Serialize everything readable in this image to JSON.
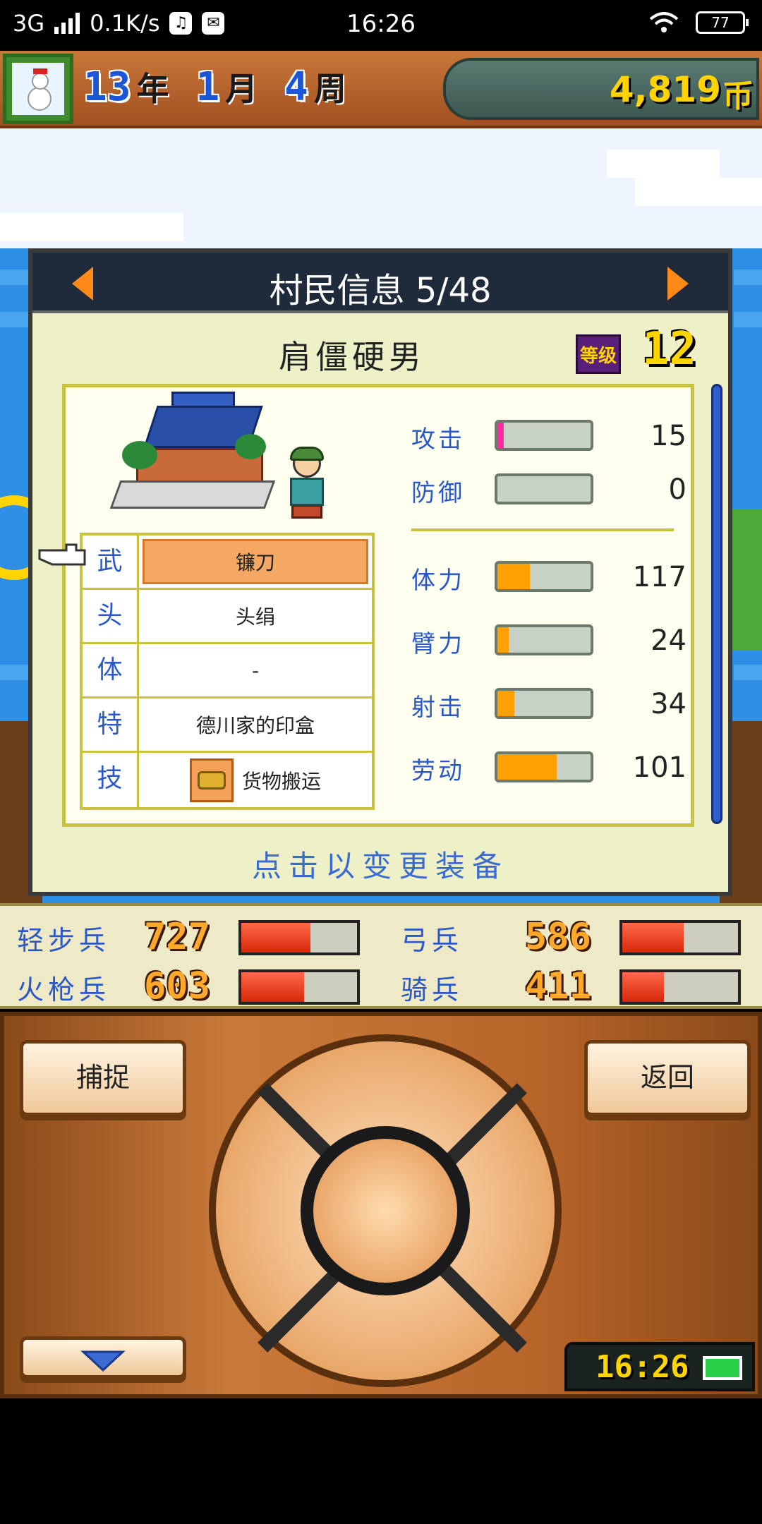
{
  "status_bar": {
    "network": "3G",
    "speed": "0.1K/s",
    "time": "16:26",
    "battery": "77"
  },
  "top_bar": {
    "year": "13",
    "year_unit": "年",
    "month": "1",
    "month_unit": "月",
    "week": "4",
    "week_unit": "周",
    "money": "4,819",
    "money_unit": "币"
  },
  "panel": {
    "title": "村民信息 5/48",
    "name": "肩僵硬男",
    "level_label": "等级",
    "level": "12",
    "hint": "点击以变更装备"
  },
  "equipment": [
    {
      "key": "武",
      "value": "镰刀"
    },
    {
      "key": "头",
      "value": "头绢"
    },
    {
      "key": "体",
      "value": "-"
    },
    {
      "key": "特",
      "value": "德川家的印盒"
    },
    {
      "key": "技",
      "value": "货物搬运"
    }
  ],
  "stats": [
    {
      "label": "攻击",
      "value": "15",
      "fraction": 0.07,
      "color": "#ff2aa0"
    },
    {
      "label": "防御",
      "value": "0",
      "fraction": 0.0,
      "color": "#ff2aa0"
    },
    {
      "label": "体力",
      "value": "117",
      "fraction": 0.35,
      "color": "#ffa000"
    },
    {
      "label": "臂力",
      "value": "24",
      "fraction": 0.12,
      "color": "#ffa000"
    },
    {
      "label": "射击",
      "value": "34",
      "fraction": 0.18,
      "color": "#ffa000"
    },
    {
      "label": "劳动",
      "value": "101",
      "fraction": 0.64,
      "color": "#ffa000"
    }
  ],
  "troops": [
    {
      "label": "轻步兵",
      "value": "727",
      "fraction": 0.6
    },
    {
      "label": "弓兵",
      "value": "586",
      "fraction": 0.53
    },
    {
      "label": "火枪兵",
      "value": "603",
      "fraction": 0.54
    },
    {
      "label": "骑兵",
      "value": "411",
      "fraction": 0.36
    }
  ],
  "controls": {
    "left_button": "捕捉",
    "right_button": "返回",
    "clock": "16:26"
  }
}
